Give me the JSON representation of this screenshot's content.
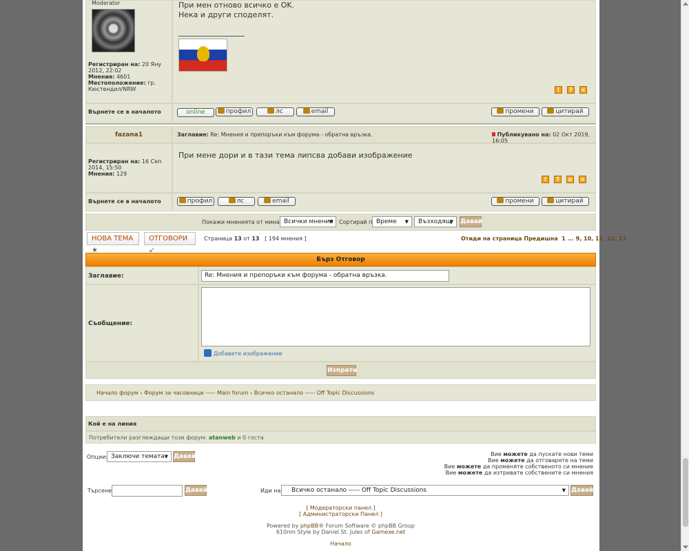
{
  "post1": {
    "rank": "Moderator",
    "registered_label": "Регистриран на:",
    "registered_value": "20 Яну 2012, 22:02",
    "posts_label": "Мнения:",
    "posts_value": "4601",
    "location_label": "Местоположение:",
    "location_value": "гр. Кюстендил/NRW",
    "body_line1": "При мен отново всичко е OK.",
    "body_line2": "Нека и други споделят.",
    "back_top": "Върнете се в началото",
    "btn_online": "online",
    "btn_profile": "профил",
    "btn_pm": "лс",
    "btn_email": "email",
    "btn_edit": "промени",
    "btn_quote": "цитирай"
  },
  "post2": {
    "author": "fazana1",
    "subject_label": "Заглавие:",
    "subject_value": "Re: Мнения и препоръки към форума - обратна връзка.",
    "posted_label": "Публикувано на:",
    "posted_value": "02 Окт 2019, 16:05",
    "registered_label": "Регистриран на:",
    "registered_value": "16 Сеп 2014, 15:50",
    "posts_label": "Мнения:",
    "posts_value": "129",
    "body": "При мене дори и в тази тема липсва добави изображение",
    "back_top": "Върнете се в началото",
    "btn_profile": "профил",
    "btn_pm": "лс",
    "btn_email": "email",
    "btn_edit": "промени",
    "btn_quote": "цитирай"
  },
  "icons": {
    "report": "!",
    "info": "?",
    "warn": "⊘",
    "delete": "×"
  },
  "sort": {
    "show_label": "Покажи мненията от миналия:",
    "show_value": "Всички мнения",
    "sort_label": "Сортирай по",
    "sort_value": "Време",
    "order_value": "Възходящ",
    "go": "Давай"
  },
  "pagination": {
    "new_topic": "НОВА ТЕМА",
    "reply": "ОТГОВОРИ",
    "page_prefix": "Страница",
    "page_current": "13",
    "page_of": "от",
    "page_total": "13",
    "posts_count": "[ 194 мнения ]",
    "goto_label": "Отиди на страница",
    "prev": "Предишна",
    "p1": "1",
    "ellipsis": "...",
    "p9": "9,",
    "p10": "10,",
    "p11": "11,",
    "p12": "12,",
    "p13": "13"
  },
  "quick_reply": {
    "title": "Бърз Отговор",
    "subject_label": "Заглавие:",
    "subject_value": "Re: Мнения и препоръки към форума - обратна връзка.",
    "message_label": "Съобщение:",
    "add_image": "Добавете изображение",
    "submit": "Изпрати"
  },
  "breadcrumb": {
    "home": "Начало форум",
    "sep": "‹",
    "forum": "Форум за часовници ----- Main forum",
    "sub": "Всичко останало ----- Off Topic Discussions"
  },
  "online": {
    "title": "Кой е на линия",
    "text": "Потребители разглеждащи този форум:",
    "user": "atanweb",
    "rest": "и 0 госта"
  },
  "options": {
    "label": "Опции:",
    "value": "Заключи темата",
    "go": "Давай"
  },
  "permissions": {
    "l1a": "Вие",
    "l1b": "можете",
    "l1c": "да пускате нови теми",
    "l2a": "Вие",
    "l2b": "можете",
    "l2c": "да отговаряте на теми",
    "l3a": "Вие",
    "l3b": "можете",
    "l3c": "да променяте собственото си мнение",
    "l4a": "Вие",
    "l4b": "можете",
    "l4c": "да изтривате собствените си мнения"
  },
  "search": {
    "label": "Търсене:",
    "go": "Давай",
    "jump_label": "Иди на:",
    "jump_value": "Всичко останало ----- Off Topic Discussions",
    "jump_go": "Давай"
  },
  "footer": {
    "mod_panel": "[ Модераторски панел ]",
    "admin_panel": "[ Администраторски Панел ]",
    "powered_a": "Powered by",
    "powered_b": "phpBB",
    "powered_c": "® Forum Software © phpBB Group",
    "style_a": "610nm Style by Daniel St. Jules of",
    "style_b": "Gamexe.net",
    "home": "Начало"
  },
  "colors": {
    "accent": "#ee7e00",
    "cell": "#e6e6d6",
    "link": "#6b4a10"
  }
}
